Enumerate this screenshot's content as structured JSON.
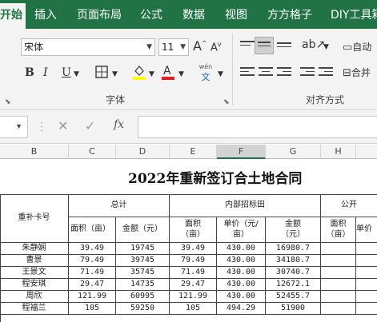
{
  "ribbon_tabs": [
    "开始",
    "插入",
    "页面布局",
    "公式",
    "数据",
    "视图",
    "方方格子",
    "DIY工具箱"
  ],
  "font": {
    "name": "宋体",
    "size": "11",
    "grow": "A",
    "shrink": "A",
    "bold": "B",
    "italic": "I",
    "underline": "U",
    "phonetic_top": "wén",
    "phonetic_bottom": "文",
    "group_label": "字体"
  },
  "alignment": {
    "group_label": "对齐方式",
    "wrap_label": "自动",
    "merge_label": "合并"
  },
  "formula_bar": {
    "cancel": "✕",
    "confirm": "✓",
    "fx": "fx",
    "value": ""
  },
  "columns": [
    "B",
    "C",
    "D",
    "E",
    "F",
    "G",
    "H"
  ],
  "selected_column": "F",
  "sheet": {
    "title": "2022年重新签订合土地合同",
    "group_headers": [
      "总计",
      "内部招标田",
      "公开"
    ],
    "row_header": "重补卡号",
    "sub_headers": [
      "面积（亩）",
      "金额（元）",
      "面积\n（亩）",
      "单价（元/\n亩）",
      "金额\n（元）",
      "面积\n（亩）",
      "单价"
    ],
    "rows": [
      [
        "朱静娴",
        "39.49",
        "19745",
        "39.49",
        "430.00",
        "16980.7"
      ],
      [
        "曹景",
        "79.49",
        "39745",
        "79.49",
        "430.00",
        "34180.7"
      ],
      [
        "王景文",
        "71.49",
        "35745",
        "71.49",
        "430.00",
        "30740.7"
      ],
      [
        "程安琪",
        "29.47",
        "14735",
        "29.47",
        "430.00",
        "12672.1"
      ],
      [
        "周欣",
        "121.99",
        "60995",
        "121.99",
        "430.00",
        "52455.7"
      ],
      [
        "程福兰",
        "105",
        "59250",
        "105",
        "494.29",
        "51900"
      ]
    ]
  }
}
